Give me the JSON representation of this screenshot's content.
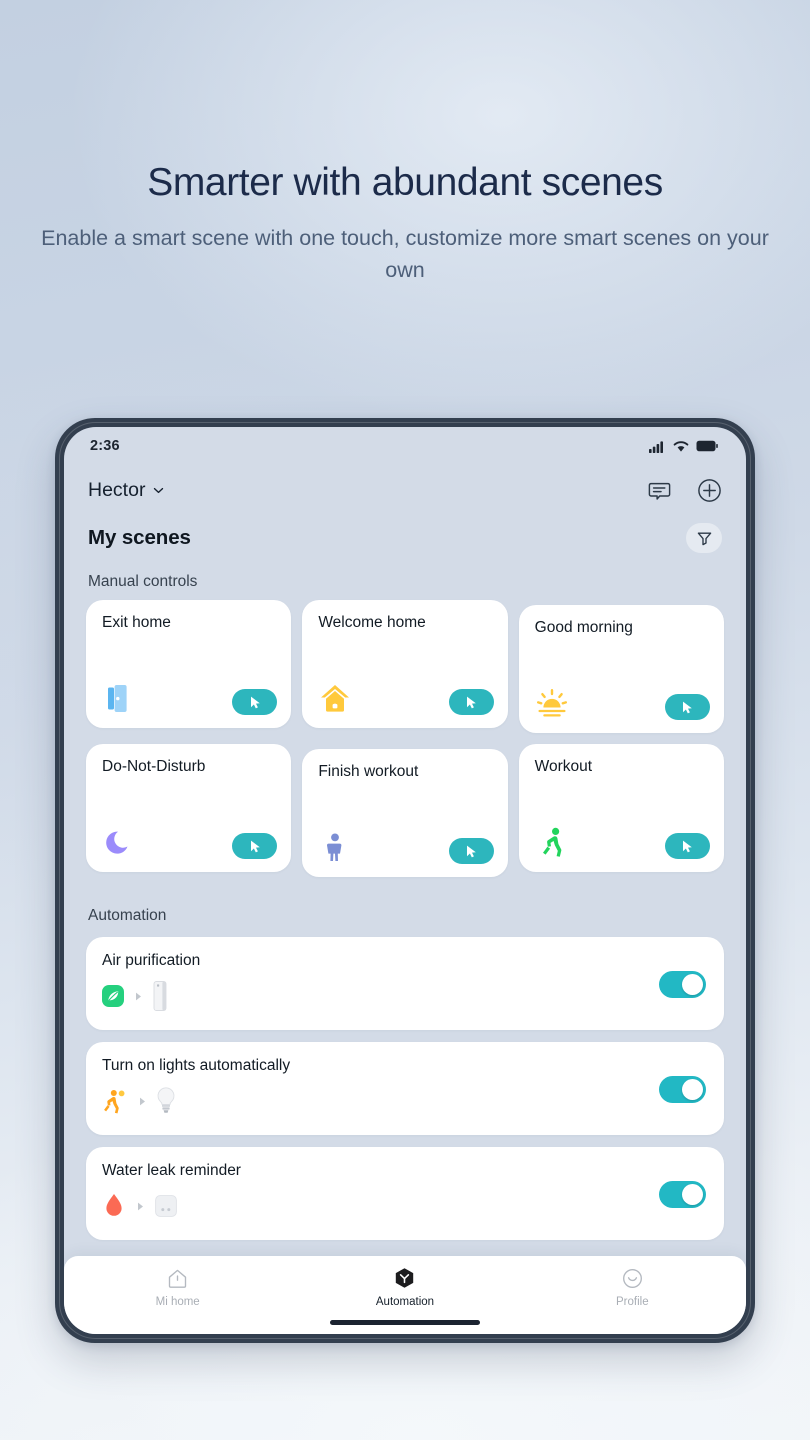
{
  "hero": {
    "title": "Smarter with abundant scenes",
    "subtitle": "Enable a smart scene with one touch, customize more smart scenes on your own"
  },
  "status_bar": {
    "time": "2:36",
    "icons": [
      "signal-icon",
      "wifi-icon",
      "battery-icon"
    ]
  },
  "app_bar": {
    "home_name": "Hector",
    "chevron_icon": "chevron-down-icon",
    "actions": [
      {
        "name": "message-icon",
        "label": "Messages"
      },
      {
        "name": "add-icon",
        "label": "Add"
      }
    ]
  },
  "page": {
    "title": "My scenes",
    "filter_icon": "filter-icon"
  },
  "sections": {
    "manual_controls_label": "Manual controls",
    "automation_label": "Automation"
  },
  "scenes": [
    {
      "name": "Exit home",
      "icon": "door-icon",
      "run_label": "Run",
      "run_icon": "cursor-icon"
    },
    {
      "name": "Welcome home",
      "icon": "house-lock-icon",
      "run_label": "Run",
      "run_icon": "cursor-icon"
    },
    {
      "name": "Good morning",
      "icon": "sunrise-icon",
      "run_label": "Run",
      "run_icon": "cursor-icon"
    },
    {
      "name": "Do-Not-Disturb",
      "icon": "moon-icon",
      "run_label": "Run",
      "run_icon": "cursor-icon"
    },
    {
      "name": "Finish workout",
      "icon": "person-idle-icon",
      "run_label": "Run",
      "run_icon": "cursor-icon"
    },
    {
      "name": "Workout",
      "icon": "person-running-icon",
      "run_label": "Run",
      "run_icon": "cursor-icon"
    }
  ],
  "automations": [
    {
      "name": "Air purification",
      "trigger_icon": "leaf-badge-icon",
      "target_icon": "air-purifier-icon",
      "enabled": true
    },
    {
      "name": "Turn on lights automatically",
      "trigger_icon": "motion-sensor-icon",
      "target_icon": "light-bulb-icon",
      "enabled": true
    },
    {
      "name": "Water leak reminder",
      "trigger_icon": "water-drop-icon",
      "target_icon": "leak-sensor-icon",
      "enabled": true
    }
  ],
  "bottom_nav": [
    {
      "label": "Mi home",
      "icon": "home-icon",
      "active": false
    },
    {
      "label": "Automation",
      "icon": "automation-icon",
      "active": true
    },
    {
      "label": "Profile",
      "icon": "profile-icon",
      "active": false
    }
  ],
  "colors": {
    "accent_teal": "#2db6bd",
    "toggle_on": "#22b8c4",
    "card_white": "#ffffff",
    "screen_bg": "#d3dbe7",
    "title_navy": "#1c2b4a"
  }
}
